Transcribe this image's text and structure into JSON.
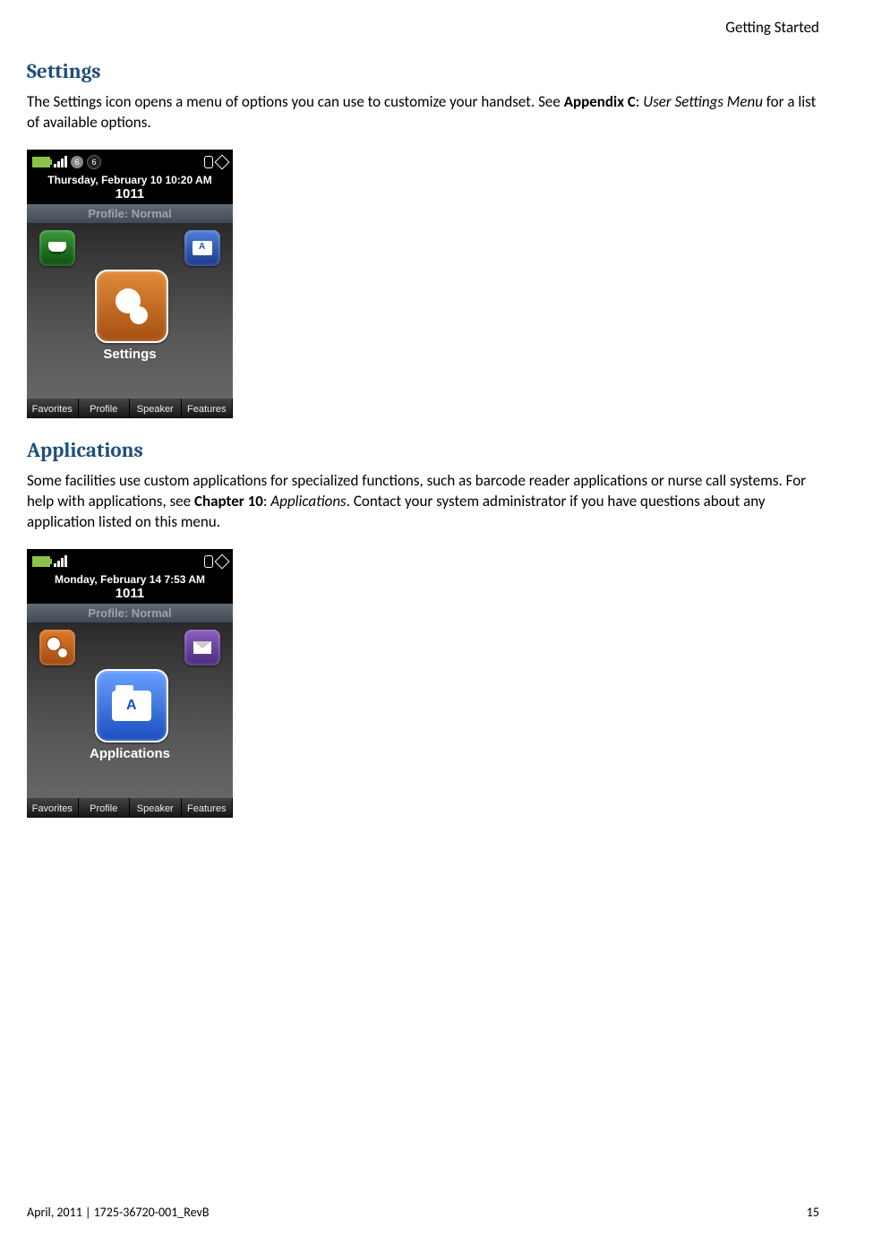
{
  "running_head": "Getting Started",
  "section1": {
    "title": "Settings",
    "para_pre": "The Settings icon opens a menu of options you can use to customize your handset. See ",
    "bold": "Appendix C",
    "colon": ": ",
    "italic": "User Settings Menu",
    "para_post": " for a list of available options."
  },
  "shot1": {
    "badge_a": "6",
    "badge_b": "6",
    "date": "Thursday, February 10 10:20 AM",
    "ext": "1011",
    "profile": "Profile: Normal",
    "center_label": "Settings",
    "softkeys": [
      "Favorites",
      "Profile",
      "Speaker",
      "Features"
    ]
  },
  "section2": {
    "title": "Applications",
    "para_pre": "Some facilities use custom applications for specialized functions, such as barcode reader applications or nurse call systems. For help with applications, see ",
    "bold": "Chapter 10",
    "colon": ": ",
    "italic": "Applications",
    "para_post": ". Contact your system administrator if you have questions about any application listed on this menu."
  },
  "shot2": {
    "date": "Monday, February 14 7:53 AM",
    "ext": "1011",
    "profile": "Profile: Normal",
    "center_label": "Applications",
    "softkeys": [
      "Favorites",
      "Profile",
      "Speaker",
      "Features"
    ]
  },
  "footer": {
    "left": "April, 2011  |  1725-36720-001_RevB",
    "right": "15"
  }
}
